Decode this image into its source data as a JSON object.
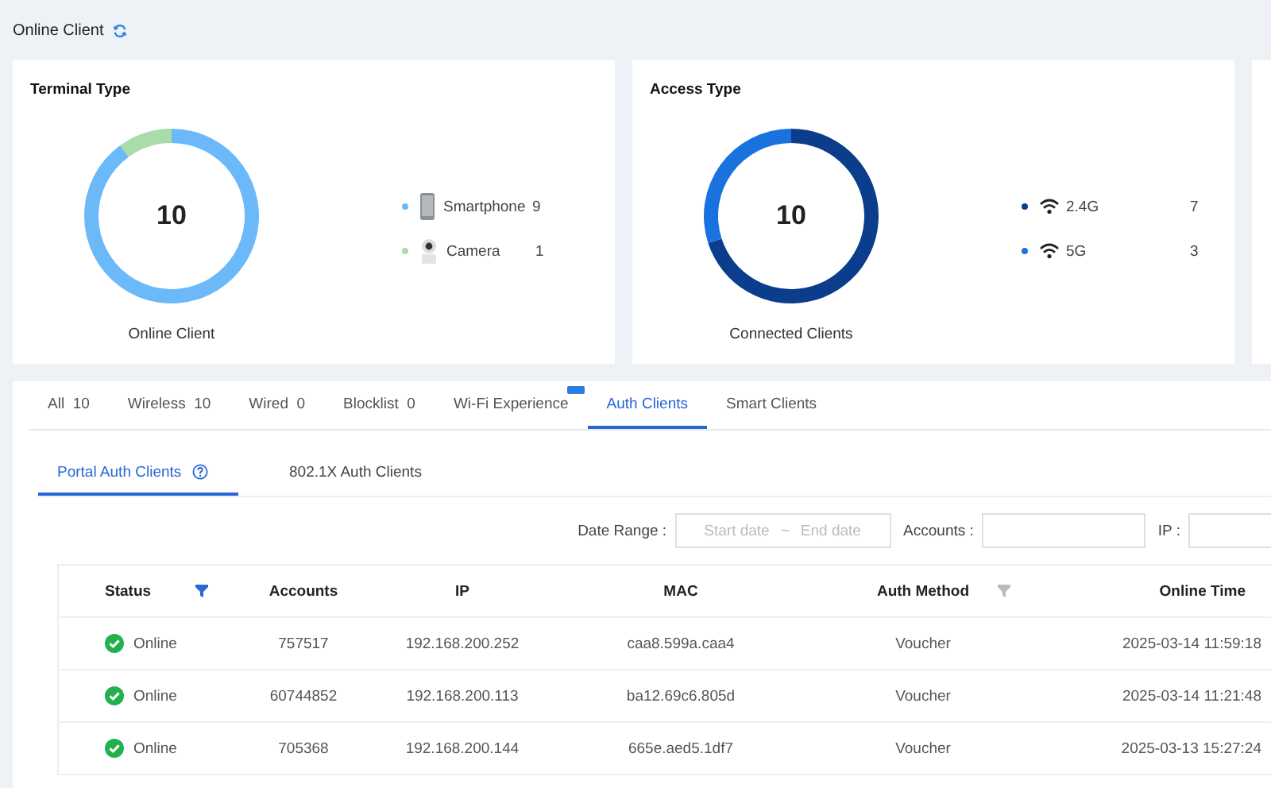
{
  "header": {
    "title": "Online Client"
  },
  "cards": [
    {
      "title": "Terminal Type",
      "total": "10",
      "caption": "Online Client",
      "legend": [
        {
          "kind": "phone",
          "name": "Smartphone",
          "count": "9",
          "color": "#6bb9f8"
        },
        {
          "kind": "camera",
          "name": "Camera",
          "count": "1",
          "color": "#a9dca9"
        }
      ]
    },
    {
      "title": "Access Type",
      "total": "10",
      "caption": "Connected Clients",
      "legend": [
        {
          "kind": "wifi",
          "name": "2.4G",
          "count": "7",
          "color": "#0b3d8c"
        },
        {
          "kind": "wifi",
          "name": "5G",
          "count": "3",
          "color": "#1a72de"
        }
      ]
    }
  ],
  "tabs": [
    {
      "label": "All  10",
      "selected": false,
      "badge": false
    },
    {
      "label": "Wireless  10",
      "selected": false,
      "badge": false
    },
    {
      "label": "Wired  0",
      "selected": false,
      "badge": false
    },
    {
      "label": "Blocklist  0",
      "selected": false,
      "badge": false
    },
    {
      "label": "Wi-Fi Experience",
      "selected": false,
      "badge": true
    },
    {
      "label": "Auth Clients",
      "selected": true,
      "badge": false
    },
    {
      "label": "Smart Clients",
      "selected": false,
      "badge": false
    }
  ],
  "subtabs": [
    {
      "label": "Portal Auth Clients",
      "selected": true,
      "help": true
    },
    {
      "label": "802.1X Auth Clients",
      "selected": false,
      "help": false
    }
  ],
  "filters": {
    "date_label": "Date Range :",
    "start_placeholder": "Start date",
    "separator": "~",
    "end_placeholder": "End date",
    "accounts_label": "Accounts :",
    "ip_label": "IP :"
  },
  "table": {
    "columns": [
      {
        "label": "Status",
        "filter_active": true
      },
      {
        "label": "Accounts"
      },
      {
        "label": "IP"
      },
      {
        "label": "MAC"
      },
      {
        "label": "Auth Method",
        "filter_active": false
      },
      {
        "label": "Online Time"
      }
    ],
    "rows": [
      {
        "status": "Online",
        "online": true,
        "account": "757517",
        "ip": "192.168.200.252",
        "mac": "caa8.599a.caa4",
        "method": "Voucher",
        "time": "2025-03-14 11:59:18"
      },
      {
        "status": "Online",
        "online": true,
        "account": "60744852",
        "ip": "192.168.200.113",
        "mac": "ba12.69c6.805d",
        "method": "Voucher",
        "time": "2025-03-14 11:21:48"
      },
      {
        "status": "Online",
        "online": true,
        "account": "705368",
        "ip": "192.168.200.144",
        "mac": "665e.aed5.1df7",
        "method": "Voucher",
        "time": "2025-03-13 15:27:24"
      }
    ]
  }
}
